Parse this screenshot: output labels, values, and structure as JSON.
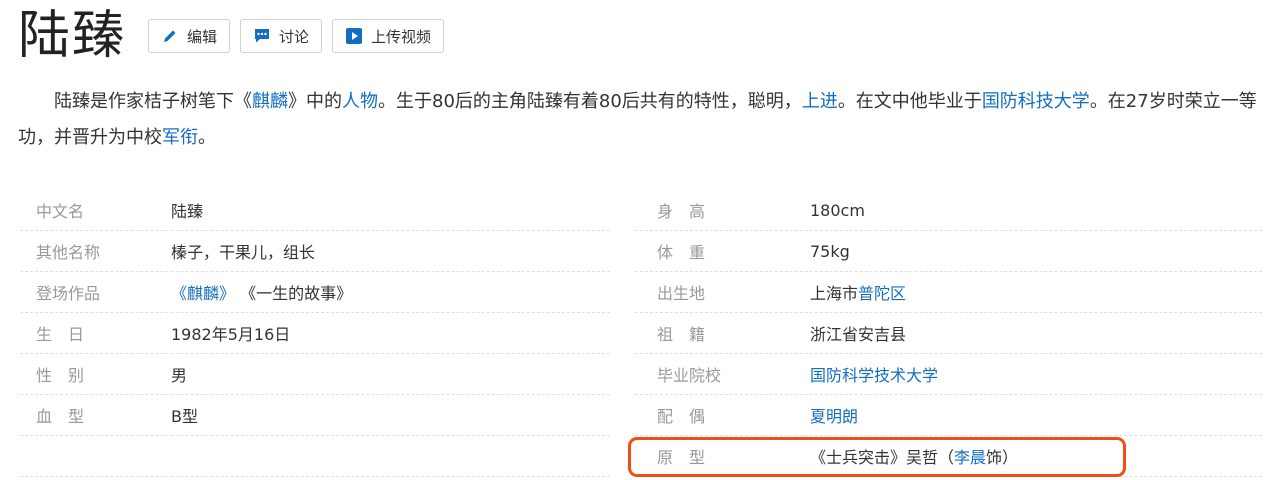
{
  "title": "陆臻",
  "toolbar": {
    "edit_label": "编辑",
    "discuss_label": "讨论",
    "upload_label": "上传视频"
  },
  "summary": {
    "t1": "陆臻是作家桔子树笔下《",
    "l1": "麒麟",
    "t2": "》中的",
    "l2": "人物",
    "t3": "。生于80后的主角陆臻有着80后共有的特性，聪明，",
    "l3": "上进",
    "t4": "。在文中他毕业于",
    "l4": "国防科技大学",
    "t5": "。在27岁时荣立一等功，并晋升为中校",
    "l5": "军衔",
    "t6": "。"
  },
  "info_left": {
    "chinese_name": {
      "key": "中文名",
      "value": "陆臻"
    },
    "other_names": {
      "key": "其他名称",
      "value": "榛子，干果儿，组长"
    },
    "works": {
      "key": "登场作品",
      "link": "《麒麟》",
      "value": "《一生的故事》"
    },
    "birthday": {
      "key": "生　日",
      "value": "1982年5月16日"
    },
    "gender": {
      "key": "性　别",
      "value": "男"
    },
    "blood": {
      "key": "血　型",
      "value": "B型"
    }
  },
  "info_right": {
    "height": {
      "key": "身　高",
      "value": "180cm"
    },
    "weight": {
      "key": "体　重",
      "value": "75kg"
    },
    "birthplace": {
      "key": "出生地",
      "value": "上海市",
      "link": "普陀区"
    },
    "ancestry": {
      "key": "祖　籍",
      "value": "浙江省安吉县"
    },
    "school": {
      "key": "毕业院校",
      "link": "国防科学技术大学"
    },
    "spouse": {
      "key": "配　偶",
      "link": "夏明朗"
    },
    "prototype": {
      "key": "原　型",
      "value_pre": "《士兵突击》吴哲（",
      "link": "李晨",
      "value_post": "饰）"
    }
  },
  "colors": {
    "link": "#136ec2",
    "highlight": "#f04e17",
    "label": "#999999"
  },
  "icons": {
    "edit": "pencil-icon",
    "discuss": "chat-icon",
    "upload": "play-icon"
  }
}
